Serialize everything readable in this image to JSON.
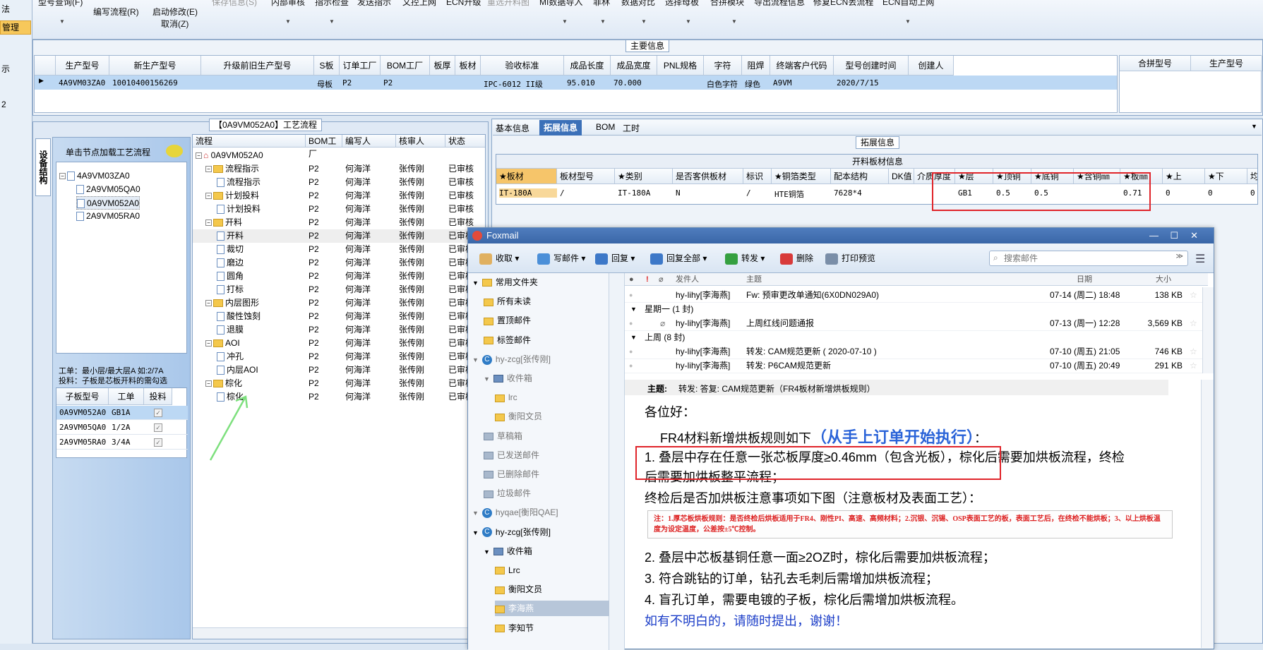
{
  "leftnav": {
    "items": [
      "法",
      "管理",
      "示",
      "2"
    ]
  },
  "ribbon": {
    "buttons": [
      "型号查询(F)",
      "编写流程(R)",
      "启动修改(E)",
      "取消(Z)",
      "保存信息(S)",
      "内部审核",
      "指示检查",
      "发送指示",
      "文控上网",
      "ECN升级",
      "重选开料图",
      "MI数据导入",
      "菲林",
      "数据对比",
      "选择母板",
      "合拼模块",
      "导出流程信息",
      "修复ECN丢流程",
      "ECN自动上网"
    ]
  },
  "main_info": {
    "title": "主要信息",
    "headers": [
      "生产型号",
      "新生产型号",
      "升级前旧生产型号",
      "S板",
      "订单工厂",
      "BOM工厂",
      "板厚",
      "板材",
      "验收标准",
      "成品长度",
      "成品宽度",
      "PNL规格",
      "字符",
      "阻焊",
      "终端客户代码",
      "型号创建时间",
      "创建人"
    ],
    "row": [
      "4A9VM03ZA0",
      "10010400156269",
      "",
      "母板",
      "P2",
      "P2",
      "",
      "",
      "IPC-6012 II级",
      "95.010",
      "70.000",
      "",
      "白色字符",
      "绿色",
      "A9VM",
      "2020/7/15",
      ""
    ],
    "side_headers": [
      "合拼型号",
      "生产型号"
    ]
  },
  "process": {
    "title": "【0A9VM052A0】工艺流程",
    "vtab": "设备结构",
    "load_hint": "单击节点加载工艺流程",
    "tree": [
      "4A9VM03ZA0",
      "2A9VM05QA0",
      "0A9VM052A0",
      "2A9VM05RA0"
    ],
    "note1": "工单：最小层/最大层A 如:2/7A",
    "note2": "投料：子板是芯板开料的需勾选",
    "sub_headers": [
      "子板型号",
      "工单",
      "投料"
    ],
    "sub_rows": [
      [
        "0A9VM052A0",
        "GB1A"
      ],
      [
        "2A9VM05QA0",
        "1/2A"
      ],
      [
        "2A9VM05RA0",
        "3/4A"
      ]
    ],
    "flow_headers": [
      "流程",
      "BOM工厂",
      "编写人",
      "核审人",
      "状态"
    ],
    "flow_root": "0A9VM052A0",
    "flow_rows": [
      {
        "name": "流程指示",
        "lvl": 1,
        "folder": true
      },
      {
        "name": "流程指示",
        "lvl": 2,
        "folder": false
      },
      {
        "name": "计划投料",
        "lvl": 1,
        "folder": true
      },
      {
        "name": "计划投料",
        "lvl": 2,
        "folder": false
      },
      {
        "name": "开料",
        "lvl": 1,
        "folder": true
      },
      {
        "name": "开料",
        "lvl": 2,
        "folder": false
      },
      {
        "name": "裁切",
        "lvl": 2,
        "folder": false
      },
      {
        "name": "磨边",
        "lvl": 2,
        "folder": false
      },
      {
        "name": "圆角",
        "lvl": 2,
        "folder": false
      },
      {
        "name": "打标",
        "lvl": 2,
        "folder": false
      },
      {
        "name": "内层图形",
        "lvl": 1,
        "folder": true
      },
      {
        "name": "酸性蚀刻",
        "lvl": 2,
        "folder": false
      },
      {
        "name": "退膜",
        "lvl": 2,
        "folder": false
      },
      {
        "name": "AOI",
        "lvl": 1,
        "folder": true
      },
      {
        "name": "冲孔",
        "lvl": 2,
        "folder": false
      },
      {
        "name": "内层AOI",
        "lvl": 2,
        "folder": false
      },
      {
        "name": "棕化",
        "lvl": 1,
        "folder": true
      },
      {
        "name": "棕化",
        "lvl": 2,
        "folder": false
      }
    ],
    "flow_bom": "P2",
    "flow_writer": "何海洋",
    "flow_checker": "张传刚",
    "flow_status": "已审核"
  },
  "ext": {
    "tabs": [
      "基本信息",
      "拓展信息",
      "BOM",
      "工时"
    ],
    "title": "拓展信息",
    "sub_title": "开料板材信息",
    "headers": [
      "★板材",
      "板材型号",
      "★类别",
      "是否客供板材",
      "标识",
      "★铜箔类型",
      "配本结构",
      "DK值",
      "介质厚度",
      "★层",
      "★顶铜",
      "★底铜",
      "★含铜㎜",
      "★板㎜",
      "★上",
      "★下",
      "均"
    ],
    "row": [
      "IT-180A",
      "/",
      "IT-180A",
      "N",
      "/",
      "HTE铜箔",
      "7628*4",
      "",
      "",
      "GB1",
      "0.5",
      "0.5",
      "",
      "0.71",
      "0",
      "0",
      "0"
    ]
  },
  "foxmail": {
    "title": "Foxmail",
    "toolbar": [
      "收取",
      "写邮件",
      "回复",
      "回复全部",
      "转发",
      "删除",
      "打印预览"
    ],
    "search_placeholder": "搜索邮件",
    "side": [
      {
        "t": "常用文件夹",
        "lvl": 0,
        "k": "f"
      },
      {
        "t": "所有未读",
        "lvl": 1,
        "k": "f"
      },
      {
        "t": "置顶邮件",
        "lvl": 1,
        "k": "s"
      },
      {
        "t": "标签邮件",
        "lvl": 1,
        "k": "t"
      },
      {
        "t": "hy-zcg[张传刚]",
        "lvl": 0,
        "k": "a",
        "g": true
      },
      {
        "t": "收件箱",
        "lvl": 1,
        "k": "i",
        "g": true
      },
      {
        "t": "lrc",
        "lvl": 2,
        "k": "f",
        "g": true
      },
      {
        "t": "衡阳文员",
        "lvl": 2,
        "k": "f",
        "g": true
      },
      {
        "t": "草稿箱",
        "lvl": 1,
        "k": "d",
        "g": true
      },
      {
        "t": "已发送邮件",
        "lvl": 1,
        "k": "d",
        "g": true
      },
      {
        "t": "已删除邮件",
        "lvl": 1,
        "k": "d",
        "g": true
      },
      {
        "t": "垃圾邮件",
        "lvl": 1,
        "k": "d",
        "g": true
      },
      {
        "t": "hyqae[衡阳QAE]",
        "lvl": 0,
        "k": "a",
        "g": true
      },
      {
        "t": "hy-zcg[张传刚]",
        "lvl": 0,
        "k": "a"
      },
      {
        "t": "收件箱",
        "lvl": 1,
        "k": "i"
      },
      {
        "t": "Lrc",
        "lvl": 2,
        "k": "f"
      },
      {
        "t": "衡阳文员",
        "lvl": 2,
        "k": "f"
      },
      {
        "t": "李海燕",
        "lvl": 2,
        "k": "f",
        "sel": true
      },
      {
        "t": "李知节",
        "lvl": 2,
        "k": "f"
      }
    ],
    "list_headers": {
      "from": "发件人",
      "subject": "主题",
      "date": "日期",
      "size": "大小"
    },
    "list_rows": [
      {
        "type": "mail",
        "from": "hy-lihy[李海燕]",
        "subject": "Fw: 预审更改单通知(6X0DN029A0)",
        "date": "07-14 (周二) 18:48",
        "size": "138 KB"
      },
      {
        "type": "group",
        "label": "星期一 (1 封)"
      },
      {
        "type": "mail",
        "from": "hy-lihy[李海燕]",
        "subject": "上周红线问题通报",
        "date": "07-13 (周一) 12:28",
        "size": "3,569 KB",
        "attach": true
      },
      {
        "type": "group",
        "label": "上周 (8 封)"
      },
      {
        "type": "mail",
        "from": "hy-lihy[李海燕]",
        "subject": "转发: CAM规范更新 ( 2020-07-10 )",
        "date": "07-10 (周五) 21:05",
        "size": "746 KB"
      },
      {
        "type": "mail",
        "from": "hy-lihy[李海燕]",
        "subject": "转发: P6CAM规范更新",
        "date": "07-10 (周五) 20:49",
        "size": "291 KB"
      }
    ],
    "body": {
      "subject_label": "主题:",
      "subject": "转发: 答复: CAM规范更新（FR4板材新增烘板规则）",
      "greeting": "各位好：",
      "intro": "FR4材料新增烘板规则如下",
      "intro_em": "（从手上订单开始执行）",
      "intro_end": "：",
      "l1a": "1. 叠层中存在任意一张芯板厚度≥0.46mm（包含光板）",
      "l1b": "，棕化后需要加烘板流程，终检",
      "l1c": "后需要加烘板整平流程；",
      "l2": "终检后是否加烘板注意事项如下图（注意板材及表面工艺）：",
      "note_red": "注：1.厚芯板烘板规则：是否终检后烘板适用于FR4、刚性PI、高速、高频材料；2.沉银、沉锡、OSP表面工艺的板，表面工艺后，在终检不能烘板；3、以上烘板温度为设定温度，公差按±5℃控制。",
      "l3": "2. 叠层中芯板基铜任意一面≥2OZ时，棕化后需要加烘板流程；",
      "l4": "3. 符合跳钻的订单，钻孔去毛刺后需增加烘板流程；",
      "l5": "4. 盲孔订单，需要电镀的子板，棕化后需增加烘板流程。",
      "closing": "如有不明白的，请随时提出，谢谢！"
    }
  }
}
